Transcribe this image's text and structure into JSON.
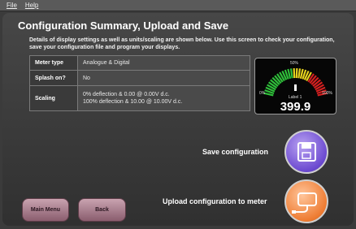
{
  "menu": {
    "file": "File",
    "help": "Help"
  },
  "page_title": "Configuration Summary, Upload and Save",
  "description": "Details of display settings as well as units/scaling are shown below. Use this screen to check your configuration, save your configuration file and program your displays.",
  "settings": [
    {
      "key": "Meter type",
      "value": "Analogue & Digital"
    },
    {
      "key": "Splash on?",
      "value": "No"
    },
    {
      "key": "Scaling",
      "value": "0% deflection & 0.00 @ 0.00V d.c.\n100% deflection & 10.00 @ 10.00V d.c."
    }
  ],
  "meter": {
    "top_label": "50%",
    "left_label": "0%",
    "right_label": "100%",
    "label": "Label 1",
    "value": "399.9",
    "colors": {
      "low": "#2fbf3a",
      "mid": "#e6d21e",
      "high": "#d42020"
    }
  },
  "actions": {
    "save_label": "Save configuration",
    "upload_label": "Upload configuration to meter",
    "save_icon": "floppy-disk-icon",
    "upload_icon": "meter-cable-icon"
  },
  "nav": {
    "main_menu": "Main Menu",
    "back": "Back"
  }
}
